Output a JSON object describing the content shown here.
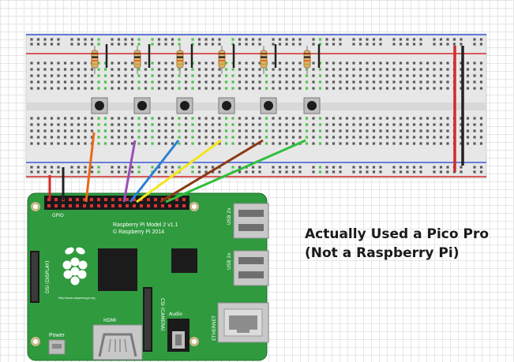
{
  "board": {
    "gpio_label": "GPIO",
    "model_line1": "Raspberry Pi Model 2 v1.1",
    "model_line2": "© Raspberry Pi 2014",
    "display_label": "DSI (DISPLAY)",
    "camera_label": "CSI (CAMERA)",
    "hdmi_label": "HDMI",
    "audio_label": "Audio",
    "ethernet_label": "ETHERNET",
    "usb_top_label": "USB 2x",
    "usb_bottom_label": "USB 2x",
    "power_label": "Power",
    "url_text": "http://www.raspberrypi.org"
  },
  "caption": {
    "line1": "Actually Used a Pico Pro",
    "line2": "(Not a Raspberry Pi)"
  },
  "colors": {
    "breadboard": "#e7e7e7",
    "rail_red": "#d42a2a",
    "rail_blue": "#3a5bd6",
    "pcb": "#2f9a3e",
    "wires": [
      "#e66b1a",
      "#9a4fb8",
      "#2b7fd6",
      "#f2e51c",
      "#8a3a12",
      "#2ec03a"
    ]
  }
}
